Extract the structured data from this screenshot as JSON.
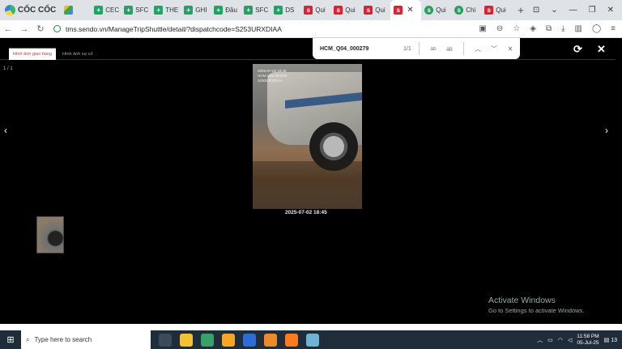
{
  "browser": {
    "brand": "CỐC CỐC",
    "tabs": [
      {
        "label": "CEC",
        "icon": "sheets-icon"
      },
      {
        "label": "SFC",
        "icon": "sheets-icon"
      },
      {
        "label": "THE",
        "icon": "sheets-icon"
      },
      {
        "label": "GHI",
        "icon": "sheets-icon"
      },
      {
        "label": "Đầu",
        "icon": "sheets-icon"
      },
      {
        "label": "SFC",
        "icon": "sheets-icon"
      },
      {
        "label": "DS",
        "icon": "sheets-icon"
      },
      {
        "label": "Qui",
        "icon": "sendo-icon"
      },
      {
        "label": "Qui",
        "icon": "sendo-icon"
      },
      {
        "label": "Qui",
        "icon": "sendo-icon"
      },
      {
        "label": "",
        "icon": "sendo-icon"
      },
      {
        "label": "Qui",
        "icon": "green-circle-icon"
      },
      {
        "label": "Chi",
        "icon": "green-circle-icon"
      },
      {
        "label": "Qui",
        "icon": "sendo-icon"
      }
    ],
    "url": "tms.sendo.vn/ManageTripShuttle/detail/?dispatchcode=S253URXDIAA"
  },
  "viewer": {
    "tab_active": "Hình ảnh giao hàng",
    "tab_other": "Hình ảnh sự cố",
    "counter": "1 / 1",
    "photo_stamp": [
      "2025-07-02 18:45",
      "HCM Q04 000279",
      "S253URXDIAA"
    ],
    "photo_date": "2025-07-02 18:45"
  },
  "find": {
    "query": "HCM_Q04_000279",
    "count": "1/1"
  },
  "activate": {
    "title": "Activate Windows",
    "subtitle": "Go to Settings to activate Windows."
  },
  "taskbar": {
    "search_placeholder": "Type here to search",
    "time": "11:58 PM",
    "date": "05-Jul-25",
    "notif_count": "13"
  }
}
